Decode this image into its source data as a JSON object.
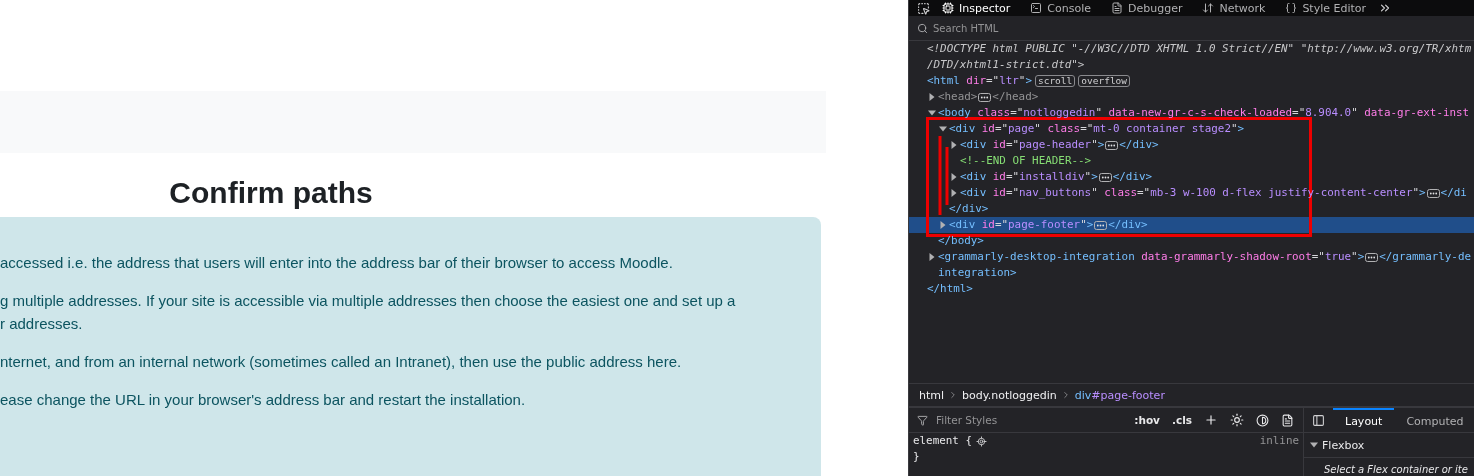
{
  "page": {
    "heading": "Confirm paths",
    "notice_paragraphs": [
      "accessed i.e. the address that users will enter into the address bar of their browser to access Moodle.",
      "g multiple addresses. If your site is accessible via multiple addresses then choose the easiest one and set up a\nr addresses.",
      "nternet, and from an internal network (sometimes called an Intranet), then use the public address here.",
      "ease change the URL in your browser's address bar and restart the installation."
    ]
  },
  "devtools": {
    "tabs": [
      {
        "label": "Inspector",
        "selected": true
      },
      {
        "label": "Console",
        "selected": false
      },
      {
        "label": "Debugger",
        "selected": false
      },
      {
        "label": "Network",
        "selected": false
      },
      {
        "label": "Style Editor",
        "selected": false
      }
    ],
    "search": {
      "placeholder": "Search HTML"
    },
    "markup": [
      {
        "selected": false,
        "lines": [
          "<!DOCTYPE html PUBLIC \"-//W3C//DTD XHTML 1.0 Strict//EN\" \"http://www.w3.org/TR/xhtm",
          "/DTD/xhtml1-strict.dtd\">"
        ]
      },
      {
        "selected": false,
        "open": [
          {
            "kind": "tag",
            "text": "<html"
          },
          {
            "kind": "attr",
            "text": " dir"
          },
          {
            "kind": "punct",
            "text": "=\""
          },
          {
            "kind": "value",
            "text": "ltr"
          },
          {
            "kind": "punct",
            "text": "\""
          },
          {
            "kind": "tag",
            "text": ">"
          }
        ],
        "badges": [
          "scroll",
          "overflow"
        ],
        "close": [
          {
            "kind": "tag",
            "text": "</html>"
          }
        ],
        "children": [
          {
            "selected": false,
            "expanded": false,
            "open": [
              {
                "kind": "dim",
                "text": "<head>"
              }
            ],
            "close": [
              {
                "kind": "dim",
                "text": "</head>"
              }
            ]
          },
          {
            "selected": false,
            "expanded": true,
            "open": [
              {
                "kind": "tag",
                "text": "<body"
              },
              {
                "kind": "attr",
                "text": " class"
              },
              {
                "kind": "punct",
                "text": "=\""
              },
              {
                "kind": "value",
                "text": "notloggedin"
              },
              {
                "kind": "punct",
                "text": "\""
              },
              {
                "kind": "attr",
                "text": " data-new-gr-c-s-check-loaded"
              },
              {
                "kind": "punct",
                "text": "=\""
              },
              {
                "kind": "value",
                "text": "8.904.0"
              },
              {
                "kind": "punct",
                "text": "\""
              },
              {
                "kind": "attr",
                "text": " data-gr-ext-inst"
              }
            ],
            "close": [
              {
                "kind": "tag",
                "text": "</body>"
              }
            ],
            "children": [
              {
                "selected": false,
                "expanded": true,
                "open": [
                  {
                    "kind": "tag",
                    "text": "<div"
                  },
                  {
                    "kind": "attr",
                    "text": " id"
                  },
                  {
                    "kind": "punct",
                    "text": "=\""
                  },
                  {
                    "kind": "value",
                    "text": "page"
                  },
                  {
                    "kind": "punct",
                    "text": "\""
                  },
                  {
                    "kind": "attr",
                    "text": " class"
                  },
                  {
                    "kind": "punct",
                    "text": "=\""
                  },
                  {
                    "kind": "value",
                    "text": "mt-0 container stage2"
                  },
                  {
                    "kind": "punct",
                    "text": "\""
                  },
                  {
                    "kind": "tag",
                    "text": ">"
                  }
                ],
                "close": [
                  {
                    "kind": "tag",
                    "text": "</div>"
                  }
                ],
                "children": [
                  {
                    "selected": false,
                    "expanded": false,
                    "open": [
                      {
                        "kind": "tag",
                        "text": "<div"
                      },
                      {
                        "kind": "attr",
                        "text": " id"
                      },
                      {
                        "kind": "punct",
                        "text": "=\""
                      },
                      {
                        "kind": "value",
                        "text": "page-header"
                      },
                      {
                        "kind": "punct",
                        "text": "\""
                      },
                      {
                        "kind": "tag",
                        "text": ">"
                      }
                    ],
                    "close": [
                      {
                        "kind": "tag",
                        "text": "</div>"
                      }
                    ]
                  },
                  {
                    "selected": false,
                    "open": [
                      {
                        "kind": "comment",
                        "text": "<!--END OF HEADER-->"
                      }
                    ]
                  },
                  {
                    "selected": false,
                    "expanded": false,
                    "open": [
                      {
                        "kind": "tag",
                        "text": "<div"
                      },
                      {
                        "kind": "attr",
                        "text": " id"
                      },
                      {
                        "kind": "punct",
                        "text": "=\""
                      },
                      {
                        "kind": "value",
                        "text": "installdiv"
                      },
                      {
                        "kind": "punct",
                        "text": "\""
                      },
                      {
                        "kind": "tag",
                        "text": ">"
                      }
                    ],
                    "close": [
                      {
                        "kind": "tag",
                        "text": "</div>"
                      }
                    ]
                  },
                  {
                    "selected": false,
                    "expanded": false,
                    "open": [
                      {
                        "kind": "tag",
                        "text": "<div"
                      },
                      {
                        "kind": "attr",
                        "text": " id"
                      },
                      {
                        "kind": "punct",
                        "text": "=\""
                      },
                      {
                        "kind": "value",
                        "text": "nav_buttons"
                      },
                      {
                        "kind": "punct",
                        "text": "\""
                      },
                      {
                        "kind": "attr",
                        "text": " class"
                      },
                      {
                        "kind": "punct",
                        "text": "=\""
                      },
                      {
                        "kind": "value",
                        "text": "mb-3 w-100 d-flex justify-content-center"
                      },
                      {
                        "kind": "punct",
                        "text": "\""
                      },
                      {
                        "kind": "tag",
                        "text": ">"
                      }
                    ],
                    "close": [
                      {
                        "kind": "tag",
                        "text": "</di"
                      }
                    ]
                  }
                ]
              },
              {
                "selected": true,
                "expanded": false,
                "open": [
                  {
                    "kind": "tag",
                    "text": "<div"
                  },
                  {
                    "kind": "attr",
                    "text": " id"
                  },
                  {
                    "kind": "punct",
                    "text": "=\""
                  },
                  {
                    "kind": "value",
                    "text": "page-footer"
                  },
                  {
                    "kind": "punct",
                    "text": "\""
                  },
                  {
                    "kind": "tag",
                    "text": ">"
                  }
                ],
                "close": [
                  {
                    "kind": "tag",
                    "text": "</div>"
                  }
                ]
              }
            ]
          },
          {
            "selected": false,
            "expanded": false,
            "open": [
              {
                "kind": "tag",
                "text": "<grammarly-desktop-integration"
              },
              {
                "kind": "attr",
                "text": " data-grammarly-shadow-root"
              },
              {
                "kind": "punct",
                "text": "=\""
              },
              {
                "kind": "value",
                "text": "true"
              },
              {
                "kind": "punct",
                "text": "\""
              },
              {
                "kind": "tag",
                "text": ">"
              }
            ],
            "close": [
              {
                "kind": "tag",
                "text": "</grammarly-de"
              }
            ],
            "continuation": [
              {
                "kind": "tag",
                "text": "integration>"
              }
            ]
          }
        ]
      }
    ],
    "breadcrumbs": [
      {
        "tag": "html",
        "selected": false
      },
      {
        "tag": "body",
        "suffix": ".notloggedin",
        "selected": false
      },
      {
        "tag": "div",
        "suffix": "#page-footer",
        "selected": true
      }
    ],
    "rules": {
      "filter_placeholder": "Filter Styles",
      "buttons": [
        ":hov",
        ".cls"
      ],
      "selector": "element {",
      "source": "inline",
      "closing": "}"
    },
    "sidebar": {
      "tabs": [
        {
          "label": "Layout",
          "selected": true
        },
        {
          "label": "Computed",
          "selected": false
        }
      ],
      "section": {
        "title": "Flexbox",
        "expanded": true,
        "hint": "Select a Flex container or ite"
      }
    }
  }
}
